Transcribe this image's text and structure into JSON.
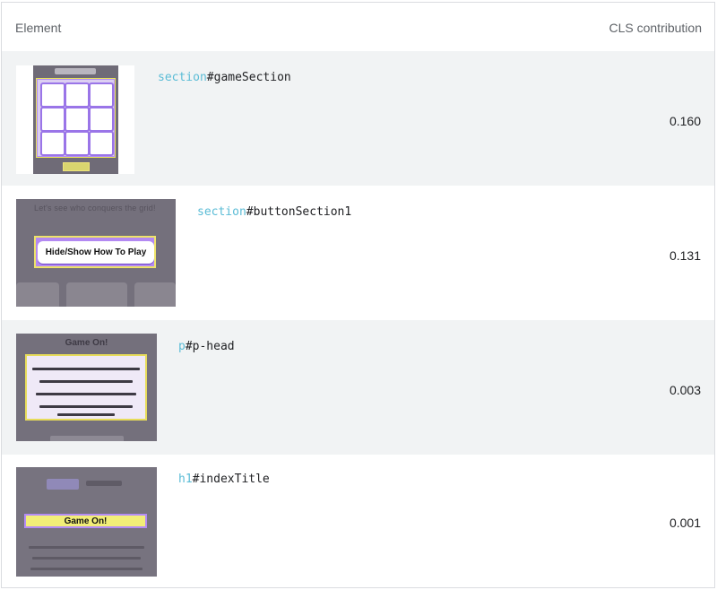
{
  "header": {
    "element_label": "Element",
    "cls_label": "CLS contribution"
  },
  "rows": [
    {
      "selector_tag": "section",
      "selector_rest": "#gameSection",
      "value": "0.160"
    },
    {
      "selector_tag": "section",
      "selector_rest": "#buttonSection1",
      "value": "0.131",
      "thumb_top_text": "Let's see who conquers the grid!",
      "thumb_button": "Hide/Show How To Play"
    },
    {
      "selector_tag": "p",
      "selector_rest": "#p-head",
      "value": "0.003",
      "thumb_title": "Game On!"
    },
    {
      "selector_tag": "h1",
      "selector_rest": "#indexTitle",
      "value": "0.001",
      "thumb_bar": "Game On!"
    }
  ],
  "colors": {
    "row_shade": "#f1f3f4",
    "selector_tag": "#5bbcd6",
    "grid_purple": "#9a75e8",
    "highlight_yellow": "#ede36a"
  }
}
